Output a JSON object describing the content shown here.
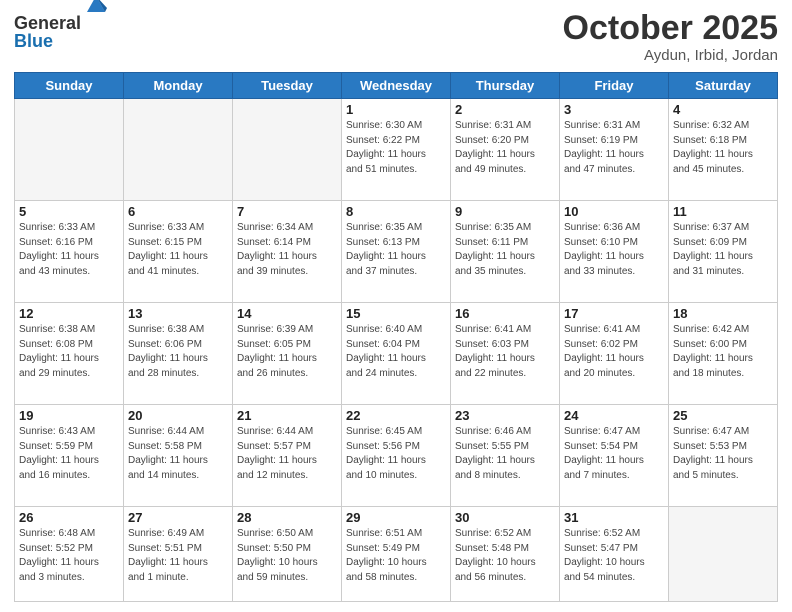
{
  "logo": {
    "general": "General",
    "blue": "Blue"
  },
  "title": "October 2025",
  "location": "Aydun, Irbid, Jordan",
  "days_of_week": [
    "Sunday",
    "Monday",
    "Tuesday",
    "Wednesday",
    "Thursday",
    "Friday",
    "Saturday"
  ],
  "weeks": [
    [
      {
        "day": "",
        "info": ""
      },
      {
        "day": "",
        "info": ""
      },
      {
        "day": "",
        "info": ""
      },
      {
        "day": "1",
        "info": "Sunrise: 6:30 AM\nSunset: 6:22 PM\nDaylight: 11 hours\nand 51 minutes."
      },
      {
        "day": "2",
        "info": "Sunrise: 6:31 AM\nSunset: 6:20 PM\nDaylight: 11 hours\nand 49 minutes."
      },
      {
        "day": "3",
        "info": "Sunrise: 6:31 AM\nSunset: 6:19 PM\nDaylight: 11 hours\nand 47 minutes."
      },
      {
        "day": "4",
        "info": "Sunrise: 6:32 AM\nSunset: 6:18 PM\nDaylight: 11 hours\nand 45 minutes."
      }
    ],
    [
      {
        "day": "5",
        "info": "Sunrise: 6:33 AM\nSunset: 6:16 PM\nDaylight: 11 hours\nand 43 minutes."
      },
      {
        "day": "6",
        "info": "Sunrise: 6:33 AM\nSunset: 6:15 PM\nDaylight: 11 hours\nand 41 minutes."
      },
      {
        "day": "7",
        "info": "Sunrise: 6:34 AM\nSunset: 6:14 PM\nDaylight: 11 hours\nand 39 minutes."
      },
      {
        "day": "8",
        "info": "Sunrise: 6:35 AM\nSunset: 6:13 PM\nDaylight: 11 hours\nand 37 minutes."
      },
      {
        "day": "9",
        "info": "Sunrise: 6:35 AM\nSunset: 6:11 PM\nDaylight: 11 hours\nand 35 minutes."
      },
      {
        "day": "10",
        "info": "Sunrise: 6:36 AM\nSunset: 6:10 PM\nDaylight: 11 hours\nand 33 minutes."
      },
      {
        "day": "11",
        "info": "Sunrise: 6:37 AM\nSunset: 6:09 PM\nDaylight: 11 hours\nand 31 minutes."
      }
    ],
    [
      {
        "day": "12",
        "info": "Sunrise: 6:38 AM\nSunset: 6:08 PM\nDaylight: 11 hours\nand 29 minutes."
      },
      {
        "day": "13",
        "info": "Sunrise: 6:38 AM\nSunset: 6:06 PM\nDaylight: 11 hours\nand 28 minutes."
      },
      {
        "day": "14",
        "info": "Sunrise: 6:39 AM\nSunset: 6:05 PM\nDaylight: 11 hours\nand 26 minutes."
      },
      {
        "day": "15",
        "info": "Sunrise: 6:40 AM\nSunset: 6:04 PM\nDaylight: 11 hours\nand 24 minutes."
      },
      {
        "day": "16",
        "info": "Sunrise: 6:41 AM\nSunset: 6:03 PM\nDaylight: 11 hours\nand 22 minutes."
      },
      {
        "day": "17",
        "info": "Sunrise: 6:41 AM\nSunset: 6:02 PM\nDaylight: 11 hours\nand 20 minutes."
      },
      {
        "day": "18",
        "info": "Sunrise: 6:42 AM\nSunset: 6:00 PM\nDaylight: 11 hours\nand 18 minutes."
      }
    ],
    [
      {
        "day": "19",
        "info": "Sunrise: 6:43 AM\nSunset: 5:59 PM\nDaylight: 11 hours\nand 16 minutes."
      },
      {
        "day": "20",
        "info": "Sunrise: 6:44 AM\nSunset: 5:58 PM\nDaylight: 11 hours\nand 14 minutes."
      },
      {
        "day": "21",
        "info": "Sunrise: 6:44 AM\nSunset: 5:57 PM\nDaylight: 11 hours\nand 12 minutes."
      },
      {
        "day": "22",
        "info": "Sunrise: 6:45 AM\nSunset: 5:56 PM\nDaylight: 11 hours\nand 10 minutes."
      },
      {
        "day": "23",
        "info": "Sunrise: 6:46 AM\nSunset: 5:55 PM\nDaylight: 11 hours\nand 8 minutes."
      },
      {
        "day": "24",
        "info": "Sunrise: 6:47 AM\nSunset: 5:54 PM\nDaylight: 11 hours\nand 7 minutes."
      },
      {
        "day": "25",
        "info": "Sunrise: 6:47 AM\nSunset: 5:53 PM\nDaylight: 11 hours\nand 5 minutes."
      }
    ],
    [
      {
        "day": "26",
        "info": "Sunrise: 6:48 AM\nSunset: 5:52 PM\nDaylight: 11 hours\nand 3 minutes."
      },
      {
        "day": "27",
        "info": "Sunrise: 6:49 AM\nSunset: 5:51 PM\nDaylight: 11 hours\nand 1 minute."
      },
      {
        "day": "28",
        "info": "Sunrise: 6:50 AM\nSunset: 5:50 PM\nDaylight: 10 hours\nand 59 minutes."
      },
      {
        "day": "29",
        "info": "Sunrise: 6:51 AM\nSunset: 5:49 PM\nDaylight: 10 hours\nand 58 minutes."
      },
      {
        "day": "30",
        "info": "Sunrise: 6:52 AM\nSunset: 5:48 PM\nDaylight: 10 hours\nand 56 minutes."
      },
      {
        "day": "31",
        "info": "Sunrise: 6:52 AM\nSunset: 5:47 PM\nDaylight: 10 hours\nand 54 minutes."
      },
      {
        "day": "",
        "info": ""
      }
    ]
  ]
}
